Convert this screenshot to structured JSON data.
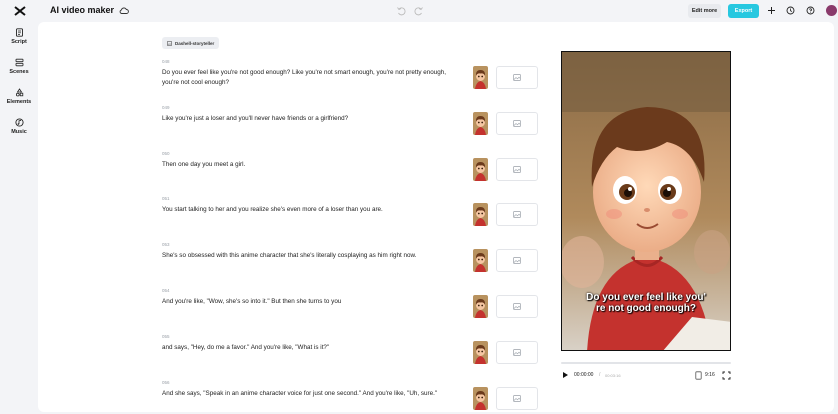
{
  "app": {
    "title": "AI video maker"
  },
  "toolbar": {
    "edit_more_label": "Edit more",
    "export_label": "Export"
  },
  "sidebar": {
    "items": [
      {
        "label": "Script",
        "icon": "script-icon"
      },
      {
        "label": "Scenes",
        "icon": "scenes-icon"
      },
      {
        "label": "Elements",
        "icon": "elements-icon"
      },
      {
        "label": "Music",
        "icon": "music-icon"
      }
    ]
  },
  "style_tag": {
    "label": "Dashell-storyteller"
  },
  "scenes": [
    {
      "num": "048",
      "text": "Do you ever feel like you're not good enough? Like you're not smart enough, you're not pretty enough, you're not cool enough?"
    },
    {
      "num": "049",
      "text": "Like you're just a loser and you'll never have friends or a girlfriend?"
    },
    {
      "num": "050",
      "text": "Then one day you meet a girl."
    },
    {
      "num": "051",
      "text": "You start talking to her and you realize she's even more of a loser than you are."
    },
    {
      "num": "053",
      "text": "She's so obsessed with this anime character that she's literally cosplaying as him right now."
    },
    {
      "num": "054",
      "text": "And you're like, \"Wow, she's so into it.\" But then she turns to you"
    },
    {
      "num": "055",
      "text": "and says, \"Hey, do me a favor.\" And you're like, \"What is it?\""
    },
    {
      "num": "056",
      "text": "And she says, \"Speak in an anime character voice for just one second.\" And you're like, \"Uh, sure.\""
    }
  ],
  "preview": {
    "caption_line1": "Do you ever feel like you'",
    "caption_line2": "re not good enough?",
    "time_current": "00:00:00",
    "time_separator": "/",
    "time_total": "00:03:16",
    "aspect_ratio": "9:16"
  },
  "colors": {
    "accent": "#27c8e0",
    "background": "#f3f4f7",
    "panel": "#ffffff"
  }
}
